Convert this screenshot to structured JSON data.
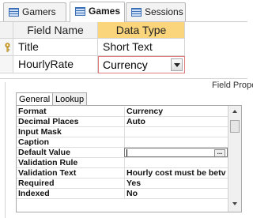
{
  "tabs": [
    {
      "label": "Gamers"
    },
    {
      "label": "Games",
      "active": true
    },
    {
      "label": "Sessions"
    }
  ],
  "design_grid": {
    "headers": {
      "field_name": "Field Name",
      "data_type": "Data Type"
    },
    "rows": [
      {
        "field_name": "Title",
        "data_type": "Short Text",
        "primary_key": true
      },
      {
        "field_name": "HourlyRate",
        "data_type": "Currency",
        "selected": true
      }
    ]
  },
  "field_properties_label": "Field Prope",
  "property_tabs": [
    {
      "label": "General",
      "active": true
    },
    {
      "label": "Lookup"
    }
  ],
  "properties": [
    {
      "name": "Format",
      "value": "Currency"
    },
    {
      "name": "Decimal Places",
      "value": "Auto"
    },
    {
      "name": "Input Mask",
      "value": ""
    },
    {
      "name": "Caption",
      "value": ""
    },
    {
      "name": "Default Value",
      "value": "",
      "builder": true,
      "builder_label": "..."
    },
    {
      "name": "Validation Rule",
      "value": ""
    },
    {
      "name": "Validation Text",
      "value": "Hourly cost must be betv"
    },
    {
      "name": "Required",
      "value": "Yes"
    },
    {
      "name": "Indexed",
      "value": "No"
    }
  ],
  "colors": {
    "accent_header": "#fbd57c",
    "selected_border": "#e07b7b"
  }
}
